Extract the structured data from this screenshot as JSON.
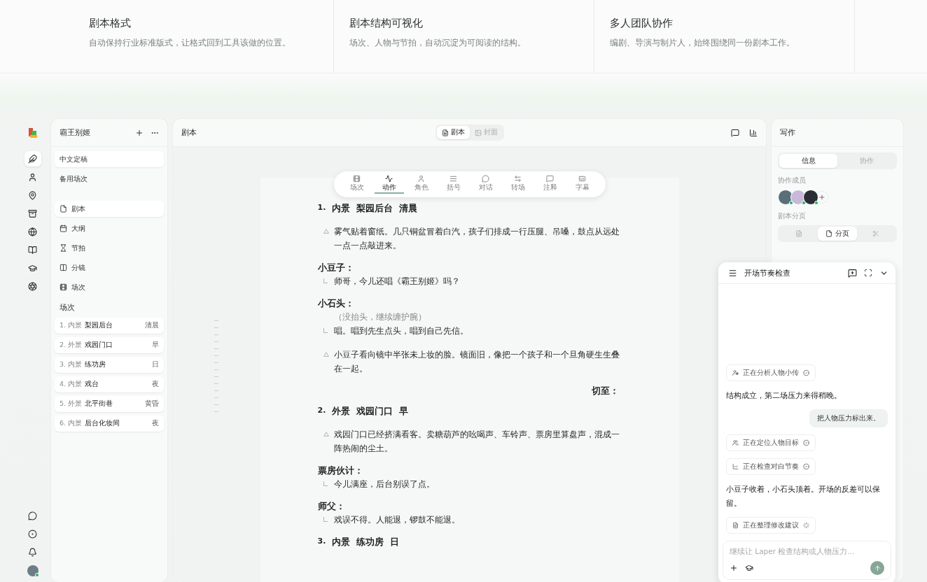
{
  "features": [
    {
      "title": "剧本格式",
      "desc": "自动保持行业标准版式，让格式回到工具该做的位置。"
    },
    {
      "title": "剧本结构可视化",
      "desc": "场次、人物与节拍，自动沉淀为可阅读的结构。"
    },
    {
      "title": "多人团队协作",
      "desc": "编剧、导演与制片人，始终围绕同一份剧本工作。"
    }
  ],
  "rail": {
    "top": [
      {
        "selected": true
      },
      {
        "selected": false
      },
      {
        "selected": false
      },
      {
        "selected": false
      },
      {
        "selected": false
      },
      {
        "selected": false
      },
      {
        "selected": false
      },
      {
        "selected": false
      }
    ],
    "user": {
      "online": true
    }
  },
  "file_panel": {
    "title": "霸王别姬",
    "drafts": [
      {
        "label": "中文定稿",
        "selected": true
      },
      {
        "label": "备用场次",
        "selected": false
      }
    ],
    "views": [
      {
        "label": "剧本",
        "selected": true
      },
      {
        "label": "大纲",
        "selected": false
      },
      {
        "label": "节拍",
        "selected": false
      },
      {
        "label": "分镜",
        "selected": false
      },
      {
        "label": "场次",
        "selected": false
      }
    ],
    "scenes_label": "场次",
    "scenes": [
      {
        "prefix": "1. 内景",
        "place": "梨园后台",
        "time": "清晨"
      },
      {
        "prefix": "2. 外景",
        "place": "戏园门口",
        "time": "早"
      },
      {
        "prefix": "3. 内景",
        "place": "练功房",
        "time": "日"
      },
      {
        "prefix": "4. 内景",
        "place": "戏台",
        "time": "夜"
      },
      {
        "prefix": "5. 外景",
        "place": "北平街巷",
        "time": "黄昏"
      },
      {
        "prefix": "6. 内景",
        "place": "后台化妆间",
        "time": "夜"
      }
    ]
  },
  "editor": {
    "title": "剧本",
    "modes": [
      {
        "label": "剧本",
        "selected": true
      },
      {
        "label": "封面",
        "selected": false
      }
    ],
    "toolbar": [
      {
        "label": "场次",
        "selected": false
      },
      {
        "label": "动作",
        "selected": true
      },
      {
        "label": "角色",
        "selected": false
      },
      {
        "label": "括号",
        "selected": false
      },
      {
        "label": "对话",
        "selected": false
      },
      {
        "label": "转场",
        "selected": false
      },
      {
        "label": "注释",
        "selected": false
      },
      {
        "label": "字幕",
        "selected": false
      }
    ],
    "script": [
      {
        "kind": "heading",
        "number": "1.",
        "text": "内景  梨园后台  清晨"
      },
      {
        "kind": "action",
        "text": "雾气贴着窗纸。几只铜盆冒着白汽，孩子们排成一行压腿、吊嗓，鼓点从远处一点一点敲进来。"
      },
      {
        "kind": "character",
        "text": "小豆子："
      },
      {
        "kind": "dialogue",
        "text": "师哥，今儿还唱《霸王别姬》吗？"
      },
      {
        "kind": "character",
        "text": "小石头："
      },
      {
        "kind": "paren",
        "text": "（没抬头，继续缠护腕）"
      },
      {
        "kind": "dialogue",
        "text": "唱。唱到先生点头，唱到自己先信。"
      },
      {
        "kind": "action",
        "text": "小豆子看向镜中半张未上妆的脸。镜面旧，像把一个孩子和一个旦角硬生生叠在一起。"
      },
      {
        "kind": "transition",
        "text": "切至："
      },
      {
        "kind": "heading",
        "number": "2.",
        "text": "外景  戏园门口  早"
      },
      {
        "kind": "action",
        "text": "戏园门口已经挤满看客。卖糖葫芦的吆喝声、车铃声、票房里算盘声，混成一阵热闹的尘土。"
      },
      {
        "kind": "character",
        "text": "票房伙计："
      },
      {
        "kind": "dialogue",
        "text": "今儿满座，后台别误了点。"
      },
      {
        "kind": "character",
        "text": "师父："
      },
      {
        "kind": "dialogue",
        "text": "戏误不得。人能退，锣鼓不能退。"
      },
      {
        "kind": "heading",
        "number": "3.",
        "text": "内景  练功房  日"
      }
    ]
  },
  "right_panel": {
    "title": "写作",
    "tabs": [
      {
        "label": "信息",
        "selected": true
      },
      {
        "label": "协作",
        "selected": false
      }
    ],
    "members_label": "协作成员",
    "members": [
      {
        "online": true,
        "color": "#5b6f7a"
      },
      {
        "online": true,
        "color": "#c9b8d8"
      },
      {
        "online": true,
        "color": "#2a2d33"
      }
    ],
    "pages_label": "剧本分页",
    "page_tabs": [
      {
        "selected": false
      },
      {
        "label": "分页",
        "selected": true
      },
      {
        "selected": false
      }
    ]
  },
  "chat": {
    "title": "开场节奏检查",
    "messages": [
      {
        "kind": "task",
        "text": "正在分析人物小传",
        "done": true
      },
      {
        "kind": "assistant",
        "text": "结构成立，第二场压力来得稍晚。"
      },
      {
        "kind": "user",
        "text": "把人物压力标出来。"
      },
      {
        "kind": "task",
        "text": "正在定位人物目标",
        "done": true
      },
      {
        "kind": "task",
        "text": "正在检查对白节奏",
        "done": true
      },
      {
        "kind": "assistant",
        "text": "小豆子收着，小石头顶着。开场的反差可以保留。"
      },
      {
        "kind": "task",
        "text": "正在整理修改建议",
        "done": false
      }
    ],
    "input": {
      "placeholder": "继续让 Laper 检查结构或人物压力..."
    }
  }
}
